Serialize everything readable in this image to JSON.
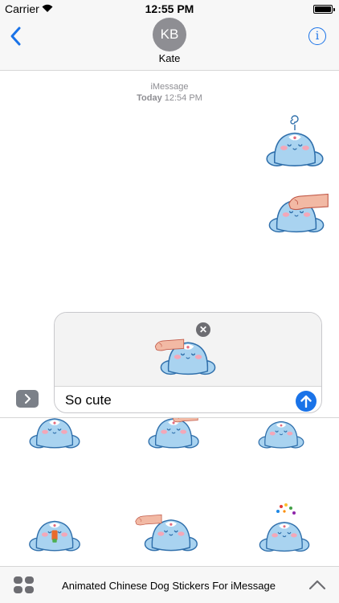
{
  "status_bar": {
    "carrier": "Carrier",
    "time": "12:55 PM"
  },
  "nav": {
    "avatar_initials": "KB",
    "contact_name": "Kate",
    "info_glyph": "i"
  },
  "transcript": {
    "service": "iMessage",
    "day": "Today",
    "time": "12:54 PM"
  },
  "compose": {
    "message_value": "So cute",
    "remove_glyph": "✕"
  },
  "bottom_bar": {
    "app_title": "Animated Chinese Dog Stickers For iMessage"
  },
  "colors": {
    "accent": "#1a73e8",
    "sticker_body": "#a9d3f0",
    "sticker_outline": "#2f6fab",
    "blush": "#f3a7b8",
    "hand": "#f2b9a4"
  },
  "icons": [
    "wifi-icon",
    "battery-icon",
    "back-chevron-icon",
    "info-icon",
    "chevron-right-icon",
    "close-icon",
    "arrow-up-icon",
    "apps-grid-icon",
    "chevron-up-icon"
  ]
}
